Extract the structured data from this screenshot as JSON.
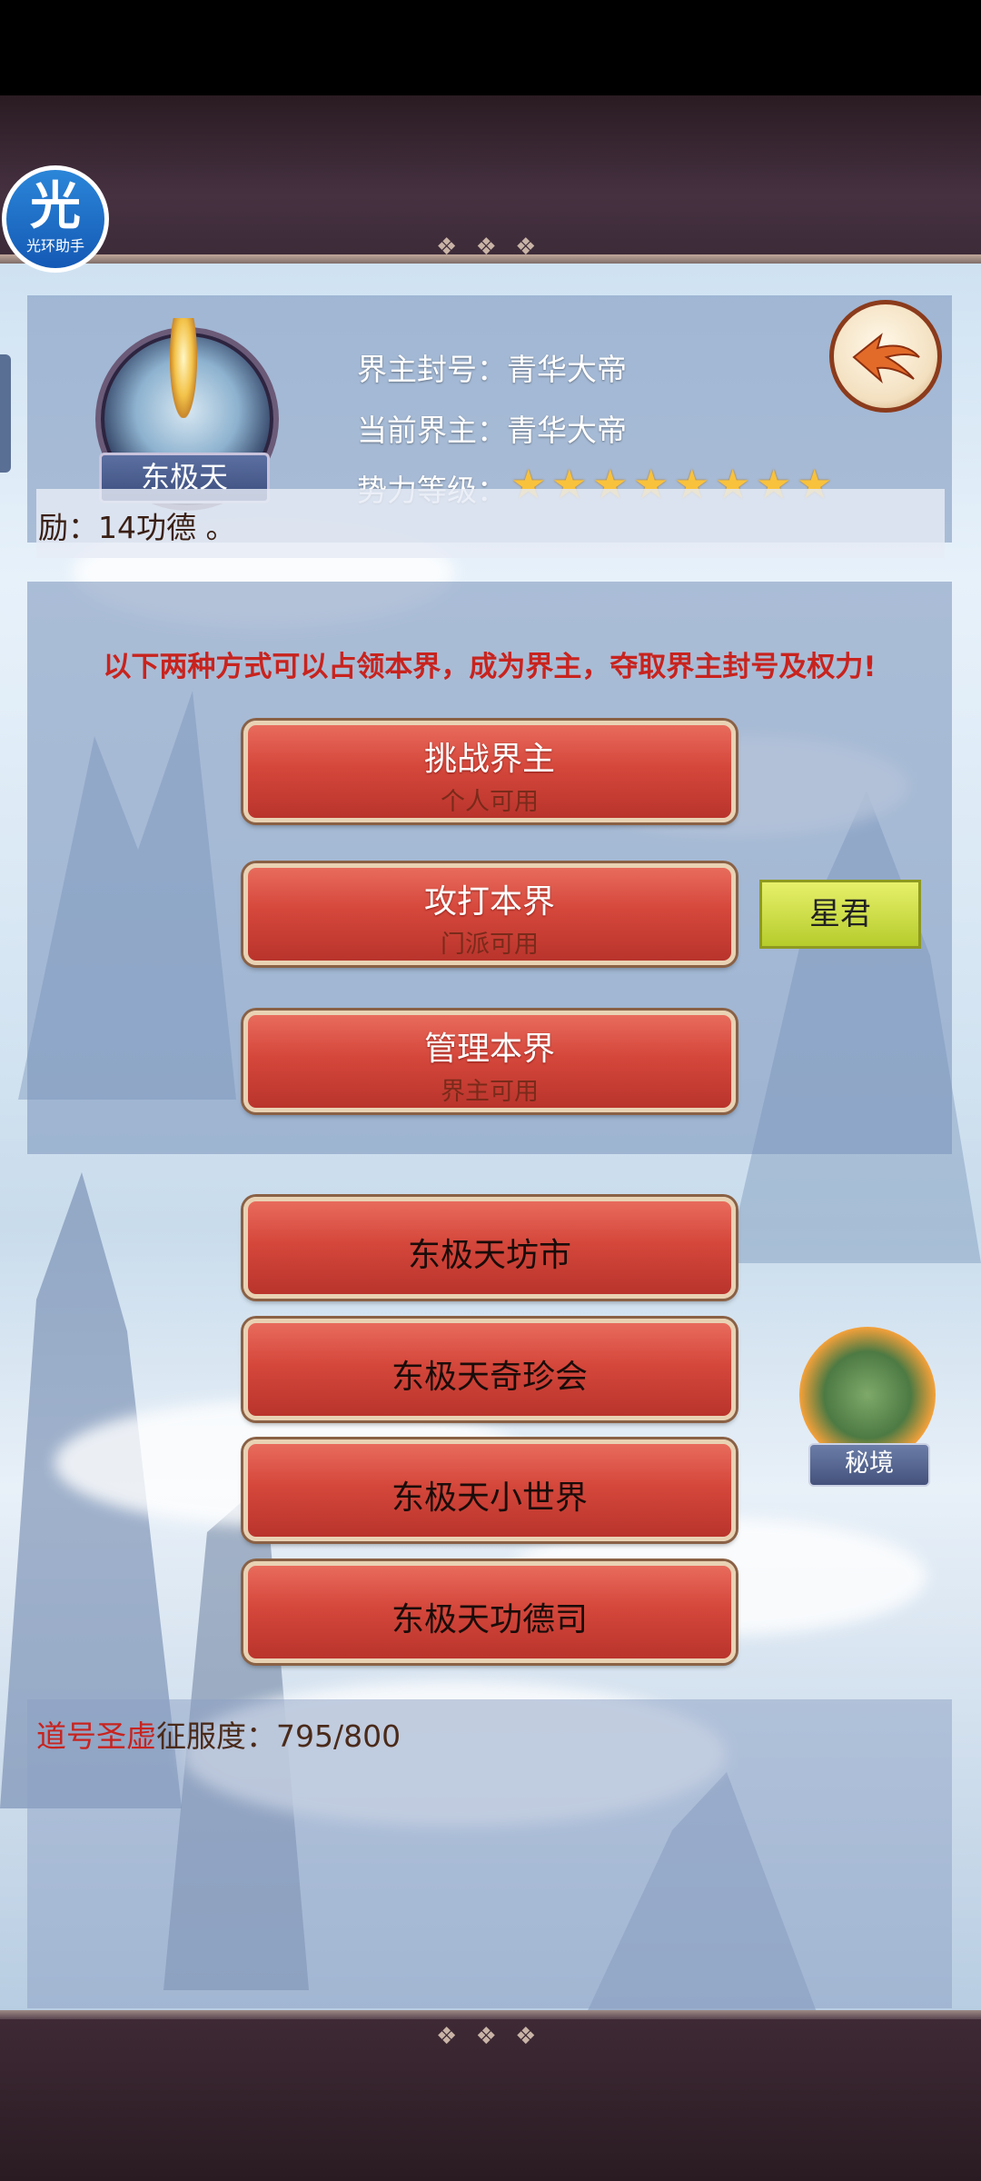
{
  "app_overlay": {
    "label": "光环助手",
    "glyph": "光"
  },
  "realm": {
    "name": "东极天",
    "title_line": "界主封号：青华大帝",
    "lord_line": "当前界主：青华大帝",
    "power_label": "势力等级：",
    "power_stars": 8,
    "reward_text": "励：14功德 。"
  },
  "claim": {
    "notice": "以下两种方式可以占领本界，成为界主，夺取界主封号及权力!",
    "buttons": [
      {
        "label": "挑战界主",
        "sub": "个人可用"
      },
      {
        "label": "攻打本界",
        "sub": "门派可用"
      },
      {
        "label": "管理本界",
        "sub": "界主可用"
      }
    ],
    "xingjun_label": "星君"
  },
  "actions": [
    {
      "label": "东极天坊市"
    },
    {
      "label": "东极天奇珍会"
    },
    {
      "label": "东极天小世界"
    },
    {
      "label": "东极天功德司"
    }
  ],
  "secret_realm": {
    "label": "秘境"
  },
  "status": {
    "name_part": "道号圣虚",
    "progress_part": "征服度：795/800",
    "conquest_value": 795,
    "conquest_max": 800
  },
  "colors": {
    "accent_red": "#d5473b",
    "notice_red": "#c8231e",
    "star_gold": "#f9c23c",
    "green_button": "#c7dc3d"
  }
}
